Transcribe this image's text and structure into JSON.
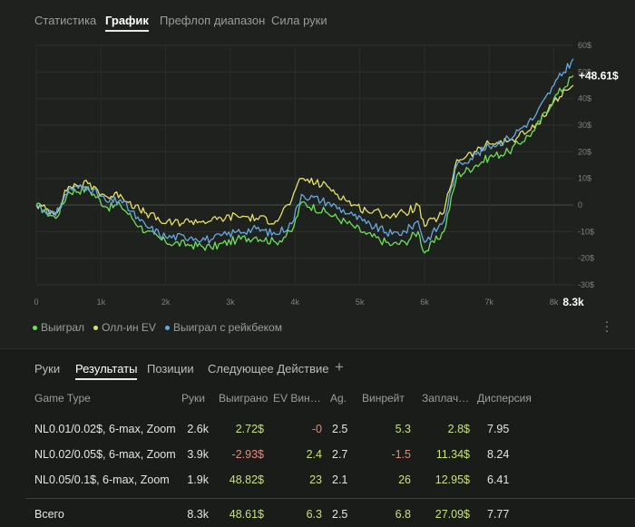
{
  "top_tabs": [
    {
      "label": "Статистика",
      "active": false
    },
    {
      "label": "График",
      "active": true
    },
    {
      "label": "Префлоп диапазон",
      "active": false
    },
    {
      "label": "Сила руки",
      "active": false
    }
  ],
  "chart_data": {
    "type": "line",
    "x_ticks": [
      "0",
      "1k",
      "2k",
      "3k",
      "4k",
      "5k",
      "6k",
      "7k",
      "8k"
    ],
    "x_end_label": "8.3k",
    "y_ticks": [
      "60$",
      "50$",
      "40$",
      "30$",
      "20$",
      "10$",
      "0",
      "-10$",
      "-20$",
      "-30$"
    ],
    "xlim": [
      0,
      8300
    ],
    "ylim": [
      -30,
      60
    ],
    "end_value_label": "+48.61$",
    "grid": true,
    "legend_position": "bottom-left",
    "series": [
      {
        "name": "Выиграл",
        "color": "#6ee05a",
        "x": [
          0,
          300,
          500,
          800,
          1100,
          1300,
          1600,
          1700,
          2000,
          2400,
          2700,
          3100,
          3400,
          3700,
          3950,
          4100,
          4500,
          4900,
          5100,
          5500,
          5700,
          5900,
          6000,
          6300,
          6500,
          6800,
          7000,
          7300,
          7700,
          8000,
          8300
        ],
        "values": [
          0,
          -5,
          5,
          6,
          -1,
          0,
          -8,
          -10,
          -14,
          -15,
          -16,
          -13,
          -12,
          -14,
          -10,
          1,
          -3,
          -8,
          -11,
          -15,
          -14,
          -10,
          -18,
          -10,
          11,
          15,
          18,
          20,
          28,
          40,
          48.61
        ]
      },
      {
        "name": "Олл-ин EV",
        "color": "#e5e06a",
        "x": [
          0,
          300,
          500,
          800,
          1100,
          1300,
          1600,
          1700,
          2000,
          2400,
          2700,
          3100,
          3400,
          3700,
          3950,
          4100,
          4500,
          4900,
          5100,
          5500,
          5700,
          5900,
          6000,
          6300,
          6500,
          6800,
          7000,
          7300,
          7700,
          8000,
          8300
        ],
        "values": [
          0,
          -3,
          7,
          8,
          3,
          4,
          -2,
          -3,
          -7,
          -6,
          -6,
          -4,
          -5,
          -6,
          2,
          10,
          7,
          0,
          -2,
          -4,
          -3,
          0,
          -8,
          -3,
          17,
          20,
          23,
          24,
          29,
          39,
          45
        ]
      },
      {
        "name": "Выиграл с рейкбеком",
        "color": "#66a9e0",
        "x": [
          0,
          300,
          500,
          800,
          1100,
          1300,
          1600,
          1700,
          2000,
          2400,
          2700,
          3100,
          3400,
          3700,
          3950,
          4100,
          4500,
          4900,
          5100,
          5500,
          5700,
          5900,
          6000,
          6300,
          6500,
          6800,
          7000,
          7300,
          7700,
          8000,
          8300
        ],
        "values": [
          0,
          -4,
          6,
          7,
          1,
          2,
          -6,
          -8,
          -12,
          -12,
          -13,
          -10,
          -9,
          -11,
          -7,
          4,
          1,
          -4,
          -7,
          -11,
          -10,
          -6,
          -14,
          -6,
          15,
          19,
          22,
          25,
          33,
          45,
          55
        ]
      }
    ]
  },
  "kebab_icon": "vertical-dots-icon",
  "bottom_tabs": [
    {
      "label": "Руки",
      "active": false
    },
    {
      "label": "Результаты",
      "active": true
    },
    {
      "label": "Позиции",
      "active": false
    },
    {
      "label": "Следующее Действие",
      "active": false
    }
  ],
  "add_tab_icon": "plus-icon",
  "add_tab_glyph": "+",
  "table": {
    "headers": [
      "Game Type",
      "Руки",
      "Выиграно",
      "EV Винрейт",
      "Ag.",
      "Винрейт",
      "Заплачено",
      "Дисперсия"
    ],
    "rows": [
      {
        "game": "NL0.01/0.02$, 6-max, Zoom",
        "hands": "2.6k",
        "won": "2.72$",
        "ev": "-0",
        "ag": "2.5",
        "winrate": "5.3",
        "paid": "2.8$",
        "disp": "7.95",
        "won_sign": "pos",
        "ev_sign": "neg",
        "winrate_sign": "pos",
        "paid_sign": "pos"
      },
      {
        "game": "NL0.02/0.05$, 6-max, Zoom",
        "hands": "3.9k",
        "won": "-2.93$",
        "ev": "2.4",
        "ag": "2.7",
        "winrate": "-1.5",
        "paid": "11.34$",
        "disp": "8.24",
        "won_sign": "neg",
        "ev_sign": "pos",
        "winrate_sign": "neg",
        "paid_sign": "pos"
      },
      {
        "game": "NL0.05/0.1$, 6-max, Zoom",
        "hands": "1.9k",
        "won": "48.82$",
        "ev": "23",
        "ag": "2.1",
        "winrate": "26",
        "paid": "12.95$",
        "disp": "6.41",
        "won_sign": "pos",
        "ev_sign": "pos",
        "winrate_sign": "pos",
        "paid_sign": "pos"
      }
    ],
    "total": {
      "game": "Всего",
      "hands": "8.3k",
      "won": "48.61$",
      "ev": "6.3",
      "ag": "2.5",
      "winrate": "6.8",
      "paid": "27.09$",
      "disp": "7.77"
    }
  }
}
